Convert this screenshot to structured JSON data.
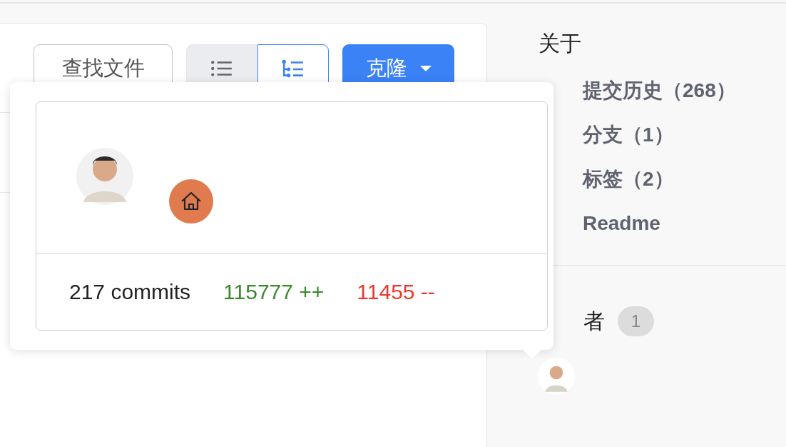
{
  "toolbar": {
    "find_file_button": "查找文件",
    "view_toggle": [
      {
        "kind": "list",
        "selected": false
      },
      {
        "kind": "tree",
        "selected": true
      }
    ],
    "clone_button": "克隆"
  },
  "popover": {
    "commits": "217 commits",
    "additions": "115777 ++",
    "deletions": "11455 --"
  },
  "sidebar": {
    "about_title": "关于",
    "links": [
      "提交历史（268）",
      "分支（1）",
      "标签（2）",
      "Readme"
    ],
    "contributors": {
      "title": "者",
      "count": "1"
    }
  }
}
